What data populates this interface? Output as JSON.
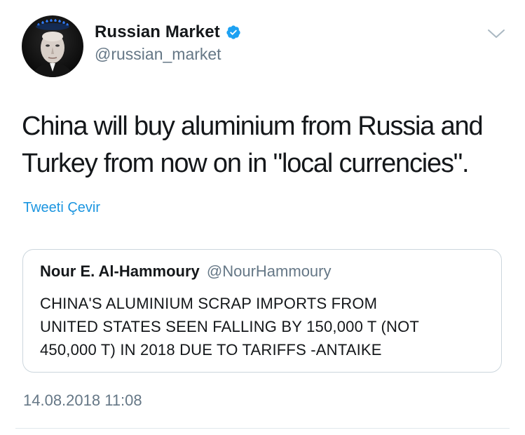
{
  "author": {
    "display_name": "Russian Market",
    "handle": "@russian_market",
    "verified": true,
    "avatar": "portrait-with-gas-flame-icon"
  },
  "tweet": {
    "text": "China will buy aluminium from Russia and\nTurkey from now on in \"local currencies\".",
    "translate_label": "Tweeti Çevir",
    "timestamp": "14.08.2018 11:08"
  },
  "quoted_tweet": {
    "display_name": "Nour E. Al-Hammoury",
    "handle": "@NourHammoury",
    "text": "CHINA'S ALUMINIUM SCRAP IMPORTS FROM\nUNITED STATES SEEN FALLING BY 150,000 T (NOT\n450,000 T) IN 2018 DUE TO TARIFFS -ANTAIKE"
  },
  "icons": {
    "verified": "verified-badge-icon",
    "menu": "chevron-down-icon"
  },
  "colors": {
    "verified": "#1da1f2",
    "link": "#1b95e0",
    "secondary_text": "#657786",
    "border": "#ccd6dd"
  }
}
